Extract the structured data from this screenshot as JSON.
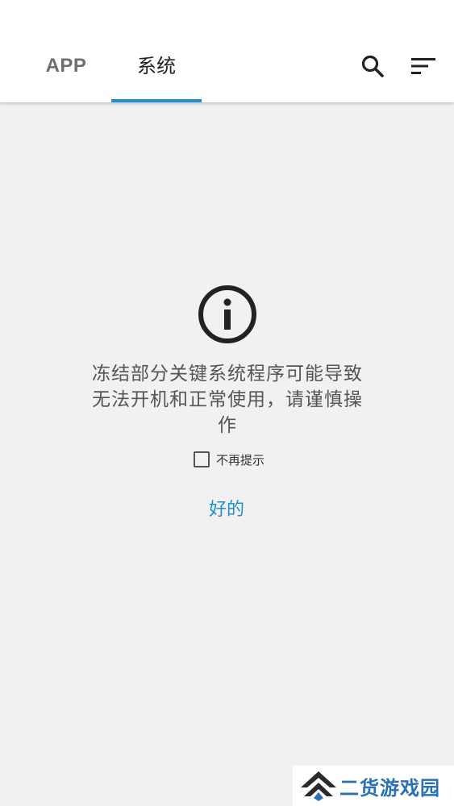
{
  "tabs": [
    {
      "label": "APP",
      "selected": false
    },
    {
      "label": "系统",
      "selected": true
    }
  ],
  "toolbar": {
    "search_icon": "search-icon",
    "sort_icon": "sort-icon"
  },
  "dialog": {
    "icon": "info-icon",
    "message": "冻结部分关键系统程序可能导致无法开机和正常使用，请谨慎操作",
    "checkbox_label": "不再提示",
    "checkbox_checked": false,
    "ok_label": "好的"
  },
  "watermark": {
    "text": "二货游戏园"
  },
  "colors": {
    "accent": "#1e8fcf",
    "background": "#f1f1f1",
    "appbar": "#ffffff"
  }
}
